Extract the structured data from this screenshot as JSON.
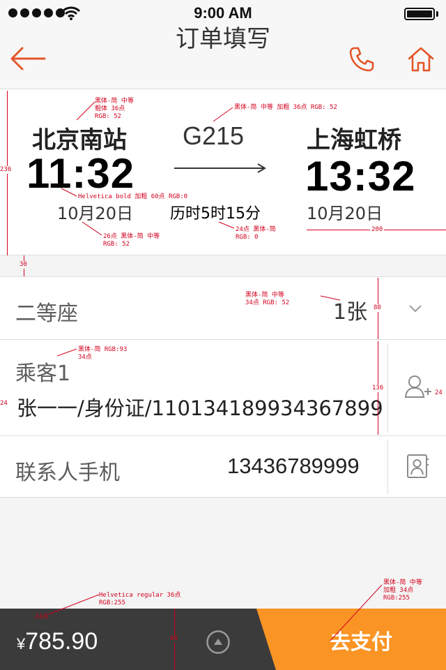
{
  "status_bar": {
    "time": "9:00 AM"
  },
  "nav": {
    "title": "订单填写"
  },
  "train": {
    "from_station": "北京南站",
    "to_station": "上海虹桥",
    "depart_time": "11:32",
    "arrive_time": "13:32",
    "depart_date": "10月20日",
    "arrive_date": "10月20日",
    "train_no": "G215",
    "duration": "历时5时15分"
  },
  "seat": {
    "label": "二等座",
    "count": "1张"
  },
  "passenger": {
    "label": "乘客1",
    "info": "张一一/身份证/110134189934367899"
  },
  "contact": {
    "label": "联系人手机",
    "phone": "13436789999"
  },
  "bottom_bar": {
    "currency": "¥",
    "amount": "785.90",
    "pay_label": "去支付"
  },
  "annotations": {
    "a1_l1": "黑体-简 中等",
    "a1_l2": "粗体 36点",
    "a1_l3": "RGB: 52",
    "a2": "黑体-简 中等 加粗 36点 RGB: 52",
    "a3": "Helvetica bold 加粗 60点 RGB:0",
    "a4_l1": "26点 黑体-简 中等",
    "a4_l2": "RGB: 52",
    "a5_l1": "24点  黑体-简",
    "a5_l2": "RGB: 0",
    "a6": "200",
    "a7": "236",
    "a8": "30",
    "a9_l1": "黑体-简 中等",
    "a9_l2": "34点  RGB: 52",
    "a10": "88",
    "a11_l1": "黑体-简 RGB:93",
    "a11_l2": "34点",
    "a12": "136",
    "a13": "24",
    "a14": "24",
    "a15_l1": "Helvetica regular 36点",
    "a15_l2": "RGB:255",
    "a16": "24点",
    "a17": "88",
    "a18_l1": "黑体-简 中等",
    "a18_l2": "加粗 34点",
    "a18_l3": "RGB:255"
  },
  "colors": {
    "accent": "#fa9424",
    "nav_icon": "#e4562a",
    "bottom_bar": "#3b3b3b",
    "annotation": "#d2001e"
  },
  "icons": [
    "back-arrow-icon",
    "phone-icon",
    "home-icon",
    "chevron-down-icon",
    "add-passenger-icon",
    "contacts-icon",
    "expand-up-icon"
  ]
}
